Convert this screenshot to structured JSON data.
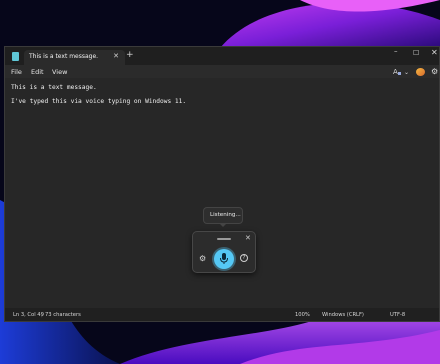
{
  "window": {
    "tab_title": "This is a text message.",
    "tab_close": "✕",
    "new_tab": "+",
    "minimize": "–",
    "maximize": "☐",
    "close": "✕"
  },
  "menu": {
    "file": "File",
    "edit": "Edit",
    "view": "View"
  },
  "toolbar": {
    "format_icon": "format-icon",
    "chevron": "⌄",
    "gear": "⚙"
  },
  "editor": {
    "lines": [
      "This is a text message.",
      "I've typed this via voice typing on Windows 11."
    ]
  },
  "status": {
    "position": "Ln 3, Col 49",
    "separator": "|",
    "characters": "73 characters",
    "zoom": "100%",
    "line_ending": "Windows (CRLF)",
    "encoding": "UTF-8"
  },
  "voice": {
    "tooltip": "Listening...",
    "close": "✕",
    "gear": "⚙",
    "help": "?",
    "mic_color": "#55c8f5"
  }
}
